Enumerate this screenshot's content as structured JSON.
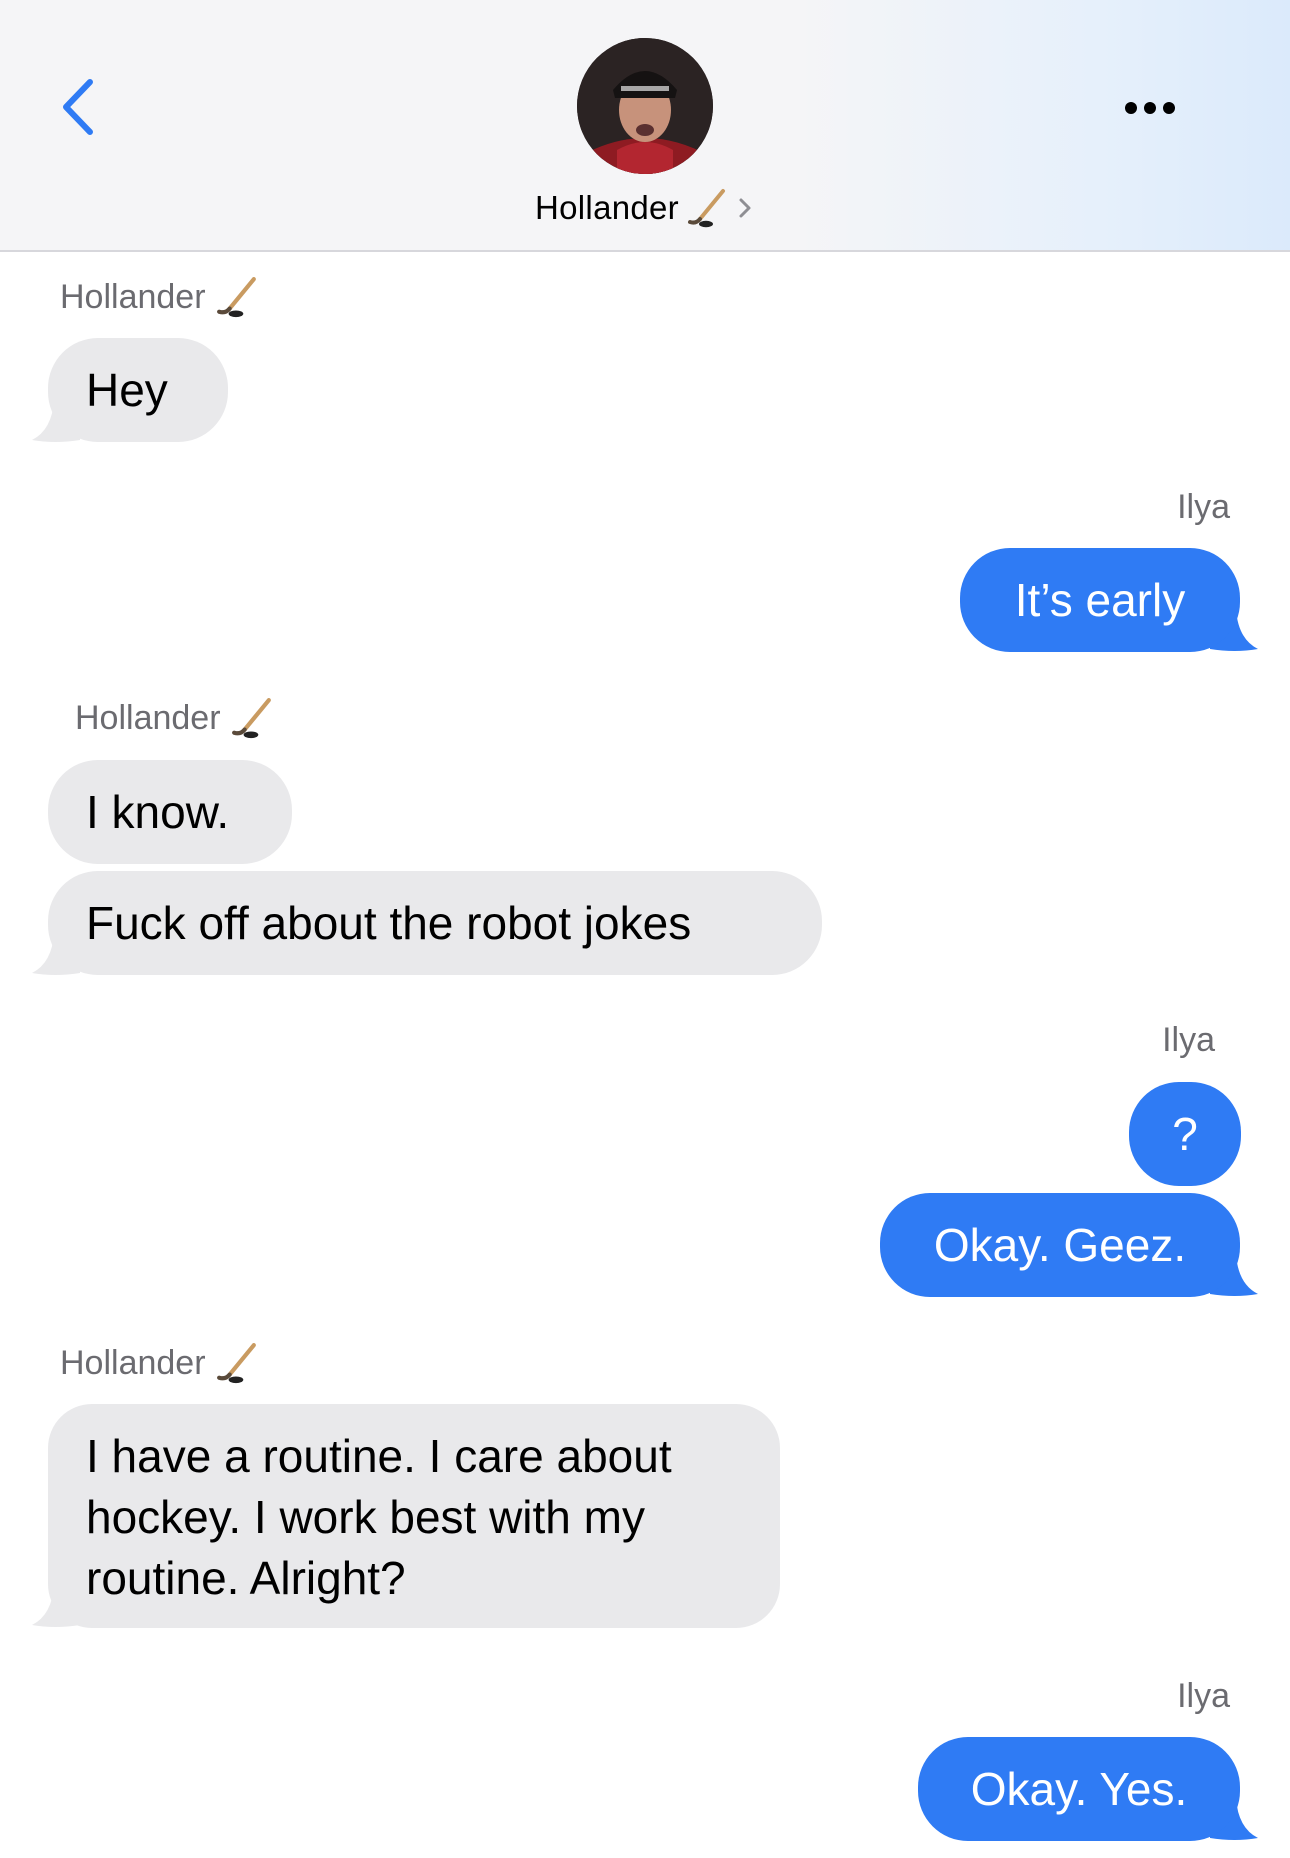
{
  "header": {
    "contact_name": "Hollander",
    "contact_emoji": "🏒",
    "icons": {
      "back": "chevron-left-icon",
      "more": "ellipsis-icon",
      "emoji": "hockey-stick-icon",
      "disclosure": "chevron-right-icon"
    },
    "colors": {
      "accent": "#2f7bf4",
      "incoming": "#e9e9eb",
      "outgoing": "#2f7bf4"
    }
  },
  "messages": [
    {
      "sender": "Hollander",
      "emoji": "🏒",
      "text": "Hey"
    },
    {
      "sender": "Ilya",
      "text": "It’s early"
    },
    {
      "sender": "Hollander",
      "emoji": "🏒",
      "text": "I know."
    },
    {
      "text": "Fuck off about the robot jokes"
    },
    {
      "sender": "Ilya",
      "text": "?"
    },
    {
      "text": "Okay. Geez."
    },
    {
      "sender": "Hollander",
      "emoji": "🏒",
      "lines": [
        "I have a routine. I care about",
        "hockey. I work best with my",
        "routine. Alright?"
      ]
    },
    {
      "sender": "Ilya",
      "text": "Okay. Yes."
    }
  ]
}
